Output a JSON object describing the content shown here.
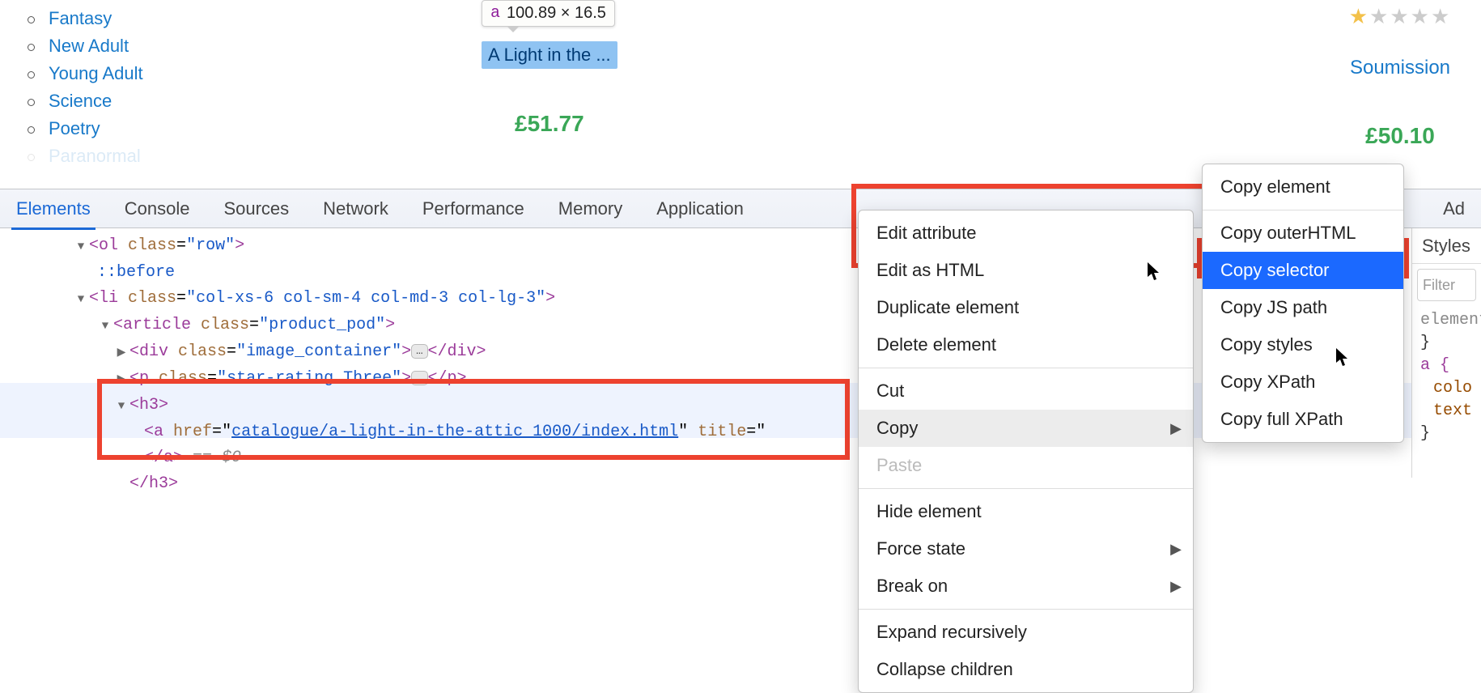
{
  "sidebar": {
    "items": [
      {
        "label": "Fantasy"
      },
      {
        "label": "New Adult"
      },
      {
        "label": "Young Adult"
      },
      {
        "label": "Science"
      },
      {
        "label": "Poetry"
      },
      {
        "label": "Paranormal"
      }
    ]
  },
  "inspect_badge": {
    "tag": "a",
    "dimensions": "100.89 × 16.5"
  },
  "product_left": {
    "selected_text": "A Light in the ...",
    "price": "£51.77"
  },
  "product_right": {
    "title": "Soumission",
    "price": "£50.10",
    "stars_filled": 1,
    "stars_total": 5
  },
  "devtools": {
    "tabs": [
      "Elements",
      "Console",
      "Sources",
      "Network",
      "Performance",
      "Memory",
      "Application",
      "Ad"
    ],
    "active_tab": 0,
    "dom": {
      "l0_text": "<ol class=\"row\">",
      "l1_text": "::before",
      "l2_text": "<li class=\"col-xs-6 col-sm-4 col-md-3 col-lg-3\">",
      "l3_text": "<article class=\"product_pod\">",
      "l4_pre": "<div class=\"image_container\">",
      "l4_post": "</div>",
      "l5_pre": "<p class=\"star-rating Three\">",
      "l5_post": "</p>",
      "l6_text": "<h3>",
      "l7_pre": "<a href=\"",
      "l7_href": "catalogue/a-light-in-the-attic_1000/index.html",
      "l7_mid": "\" title=\"",
      "l8_text": "</a>",
      "l8_eq": " == ",
      "l8_dollar": "$0",
      "l9_text": "</h3>"
    },
    "context_menu": [
      {
        "label": "Edit attribute"
      },
      {
        "label": "Edit as HTML"
      },
      {
        "label": "Duplicate element"
      },
      {
        "label": "Delete element"
      },
      {
        "sep": true
      },
      {
        "label": "Cut"
      },
      {
        "label": "Copy",
        "submenu": true,
        "hover": "gray"
      },
      {
        "label": "Paste"
      },
      {
        "sep": true
      },
      {
        "label": "Hide element"
      },
      {
        "label": "Force state",
        "submenu": true
      },
      {
        "label": "Break on",
        "submenu": true
      },
      {
        "sep": true
      },
      {
        "label": "Expand recursively"
      },
      {
        "label": "Collapse children"
      }
    ],
    "copy_submenu": [
      {
        "label": "Copy element"
      },
      {
        "sep": true
      },
      {
        "label": "Copy outerHTML"
      },
      {
        "label": "Copy selector",
        "hover": "blue"
      },
      {
        "label": "Copy JS path"
      },
      {
        "label": "Copy styles"
      },
      {
        "label": "Copy XPath"
      },
      {
        "label": "Copy full XPath"
      }
    ]
  },
  "styles_panel": {
    "tab": "Styles",
    "filter_placeholder": "Filter",
    "rule1_sel": "element",
    "rule1_close": "}",
    "rule2_sel": "a {",
    "rule2_p1": "colo",
    "rule2_p2": "text",
    "rule2_close": "}"
  }
}
